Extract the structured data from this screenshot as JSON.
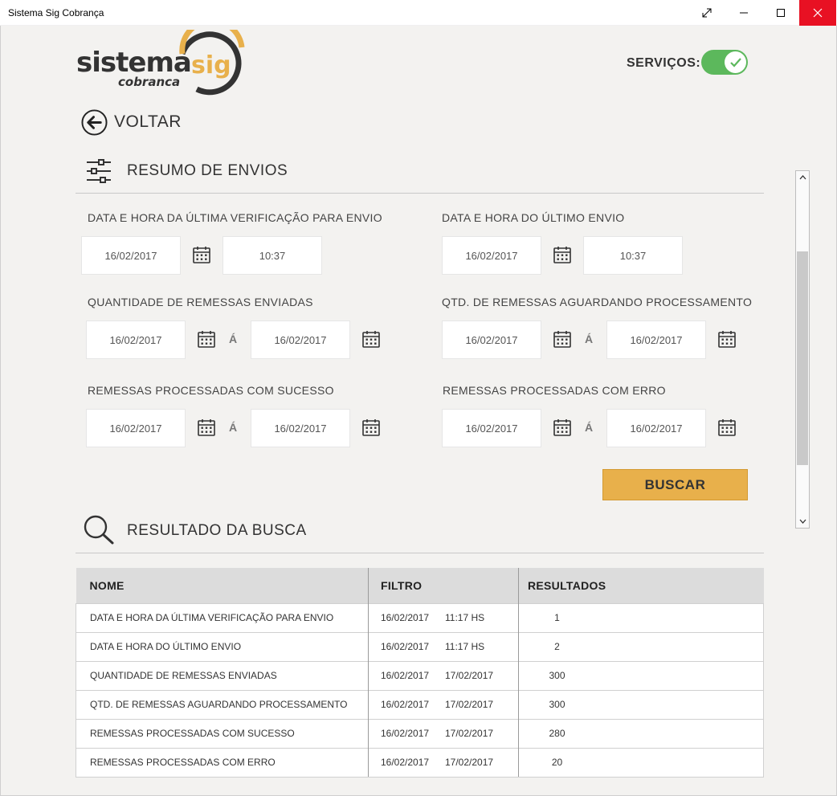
{
  "window": {
    "title": "Sistema Sig Cobrança"
  },
  "header": {
    "logo_text": "sistema sig cobranca",
    "servicos_label": "SERVIÇOS:",
    "servicos_on": true
  },
  "nav": {
    "back_label": "VOLTAR"
  },
  "resumo": {
    "title": "RESUMO DE ENVIOS",
    "ultima_verificacao": {
      "label": "DATA E HORA DA ÚLTIMA VERIFICAÇÃO PARA ENVIO",
      "date": "16/02/2017",
      "time": "10:37"
    },
    "ultimo_envio": {
      "label": "DATA E HORA DO ÚLTIMO ENVIO",
      "date": "16/02/2017",
      "time": "10:37"
    },
    "quantidade_enviadas": {
      "label": "QUANTIDADE DE REMESSAS ENVIADAS",
      "from": "16/02/2017",
      "to": "16/02/2017"
    },
    "aguardando": {
      "label": "QTD. DE REMESSAS AGUARDANDO PROCESSAMENTO",
      "from": "16/02/2017",
      "to": "16/02/2017"
    },
    "sucesso": {
      "label": "REMESSAS PROCESSADAS COM SUCESSO",
      "from": "16/02/2017",
      "to": "16/02/2017"
    },
    "erro": {
      "label": "REMESSAS PROCESSADAS COM ERRO",
      "from": "16/02/2017",
      "to": "16/02/2017"
    },
    "range_sep": "Á",
    "buscar_label": "BUSCAR"
  },
  "resultado": {
    "title": "RESULTADO DA BUSCA",
    "columns": [
      "NOME",
      "FILTRO",
      "RESULTADOS"
    ],
    "rows": [
      {
        "nome": "DATA E HORA DA ÚLTIMA VERIFICAÇÃO PARA ENVIO",
        "filtro1": "16/02/2017",
        "filtro2": "11:17 HS",
        "resultado": "1"
      },
      {
        "nome": "DATA E HORA DO ÚLTIMO ENVIO",
        "filtro1": "16/02/2017",
        "filtro2": "11:17 HS",
        "resultado": "2"
      },
      {
        "nome": "QUANTIDADE DE REMESSAS ENVIADAS",
        "filtro1": "16/02/2017",
        "filtro2": "17/02/2017",
        "resultado": "300"
      },
      {
        "nome": "QTD. DE REMESSAS AGUARDANDO PROCESSAMENTO",
        "filtro1": "16/02/2017",
        "filtro2": "17/02/2017",
        "resultado": "300"
      },
      {
        "nome": "REMESSAS PROCESSADAS COM SUCESSO",
        "filtro1": "16/02/2017",
        "filtro2": "17/02/2017",
        "resultado": "280"
      },
      {
        "nome": "REMESSAS PROCESSADAS COM ERRO",
        "filtro1": "16/02/2017",
        "filtro2": "17/02/2017",
        "resultado": "20"
      }
    ]
  },
  "colors": {
    "accent": "#e8b04b",
    "toggle_on": "#5cb85c",
    "close_red": "#e81123"
  }
}
